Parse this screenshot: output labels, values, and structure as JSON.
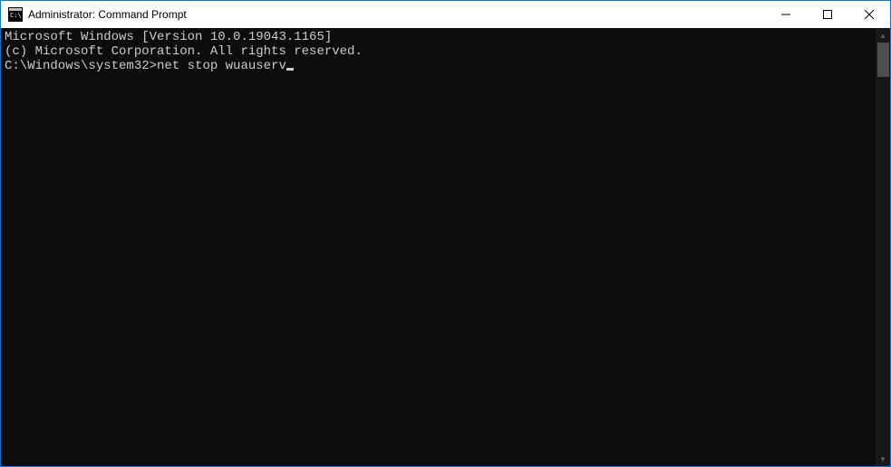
{
  "window": {
    "title": "Administrator: Command Prompt"
  },
  "terminal": {
    "line1": "Microsoft Windows [Version 10.0.19043.1165]",
    "line2": "(c) Microsoft Corporation. All rights reserved.",
    "blank": "",
    "prompt": "C:\\Windows\\system32>",
    "command": "net stop wuauserv"
  }
}
